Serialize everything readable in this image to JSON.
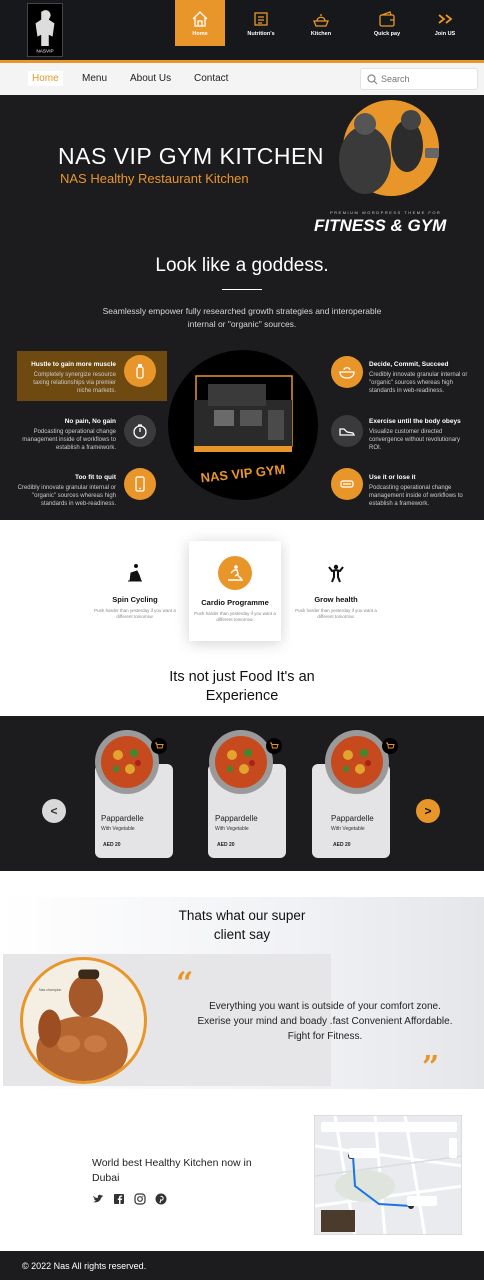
{
  "brand": {
    "logo_text": "NASVIP"
  },
  "topnav": [
    {
      "label": "Home",
      "icon": "home-icon",
      "active": true
    },
    {
      "label": "Nutrition's",
      "icon": "nutrition-icon",
      "active": false
    },
    {
      "label": "Kitchen",
      "icon": "kitchen-icon",
      "active": false
    },
    {
      "label": "Quick pay",
      "icon": "wallet-icon",
      "active": false
    },
    {
      "label": "Join US",
      "icon": "double-chevron-icon",
      "active": false
    }
  ],
  "subnav": {
    "links": [
      "Home",
      "Menu",
      "About Us",
      "Contact"
    ],
    "active": "Home",
    "search_placeholder": "Search"
  },
  "hero": {
    "title": "NAS VIP GYM KITCHEN",
    "subtitle": "NAS Healthy Restaurant Kitchen",
    "badge_small": "PREMIUM WORDPRESS THEME FOR",
    "badge_big": "FITNESS & GYM",
    "headline": "Look like a goddess.",
    "description": "Seamlessly empower fully researched growth strategies and interoperable internal or \"organic\" sources.",
    "center_sign": "NAS VIP GYM",
    "features_left": [
      {
        "title": "Hustle to gain more muscle",
        "text": "Completely synergize resource taxing relationships via premier niche markets.",
        "icon": "bottle-icon"
      },
      {
        "title": "No pain, No gain",
        "text": "Podcasting operational change management inside of workflows to establish a framework.",
        "icon": "stopwatch-icon"
      },
      {
        "title": "Too fit to quit",
        "text": "Credibly innovate granular internal or \"organic\" sources whereas high standards in web-readiness.",
        "icon": "phone-icon"
      }
    ],
    "features_right": [
      {
        "title": "Decide, Commit, Succeed",
        "text": "Credibly innovate granular internal or \"organic\" sources whereas high standards in web-readiness.",
        "icon": "bowl-icon"
      },
      {
        "title": "Exercise until the body obeys",
        "text": "Visualize customer directed convergence without revolutionary ROI.",
        "icon": "shoe-icon"
      },
      {
        "title": "Use it or lose it",
        "text": "Podcasting operational change management inside of workflows to establish a framework.",
        "icon": "scale-icon"
      }
    ]
  },
  "programmes": [
    {
      "title": "Spin Cycling",
      "text": "Push harder than yesterday if you want a different tomorrow.",
      "icon": "cycling-icon"
    },
    {
      "title": "Cardio Programme",
      "text": "Push harder than yesterday if you want a different tomorrow.",
      "icon": "treadmill-icon"
    },
    {
      "title": "Grow health",
      "text": "Push harder than yesterday if you want a different tomorrow.",
      "icon": "flex-icon"
    }
  ],
  "experience_title": "Its not just Food It's an Experience",
  "products": {
    "items": [
      {
        "name": "Pappardelle",
        "sub": "With Vegetable",
        "price": "AED 20"
      },
      {
        "name": "Pappardelle",
        "sub": "With Vegetable",
        "price": "AED 20"
      },
      {
        "name": "Pappardelle",
        "sub": "With Vegetable",
        "price": "AED 20"
      }
    ],
    "prev": "<",
    "next": ">"
  },
  "testimonial": {
    "title": "Thats what our super client say",
    "avatar_caption": "Nas champion",
    "quote_open": "“",
    "quote_close": "”",
    "text": "Everything you want is outside of your comfort zone. Exerise your mind and boady .fast Convenient Affordable. Fight for Fitness."
  },
  "contact": {
    "text": "World best Healthy Kitchen now in  Dubai",
    "social": [
      "twitter-icon",
      "facebook-icon",
      "instagram-icon",
      "pinterest-icon"
    ]
  },
  "footer": {
    "text": "© 2022 Nas All rights reserved."
  },
  "colors": {
    "accent": "#e8962a",
    "dark": "#1c1c1e",
    "topbar": "#17181b"
  }
}
